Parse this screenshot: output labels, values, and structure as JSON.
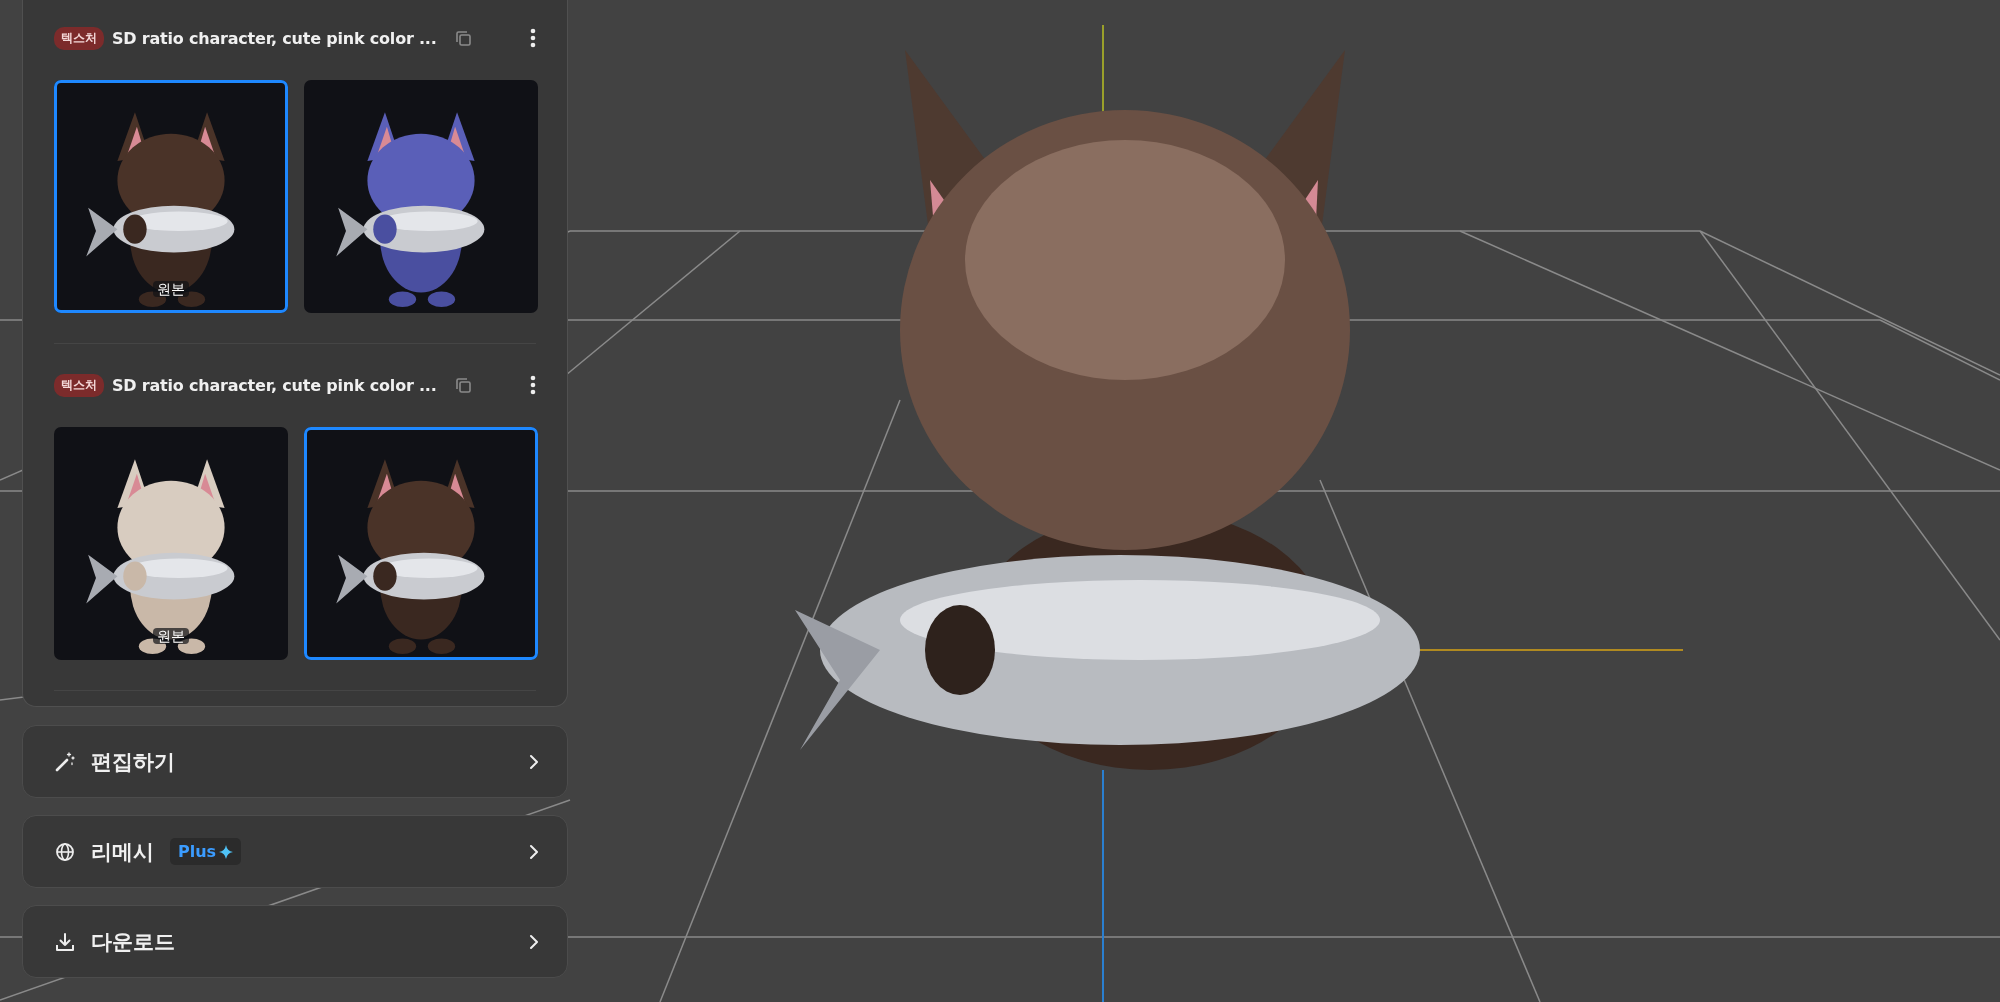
{
  "cards": [
    {
      "tag": "텍스처",
      "title": "SD ratio character, cute pink color ...",
      "thumbnails": [
        {
          "label": "원본",
          "selected": true
        },
        {
          "selected": false
        }
      ]
    },
    {
      "tag": "텍스처",
      "title": "SD ratio character, cute pink color ...",
      "thumbnails": [
        {
          "label": "원본",
          "selected": false
        },
        {
          "selected": true
        }
      ]
    }
  ],
  "actions": [
    {
      "kind": "edit",
      "label": "편집하기"
    },
    {
      "kind": "remesh",
      "label": "리메시",
      "badge": "Plus"
    },
    {
      "kind": "download",
      "label": "다운로드"
    }
  ]
}
